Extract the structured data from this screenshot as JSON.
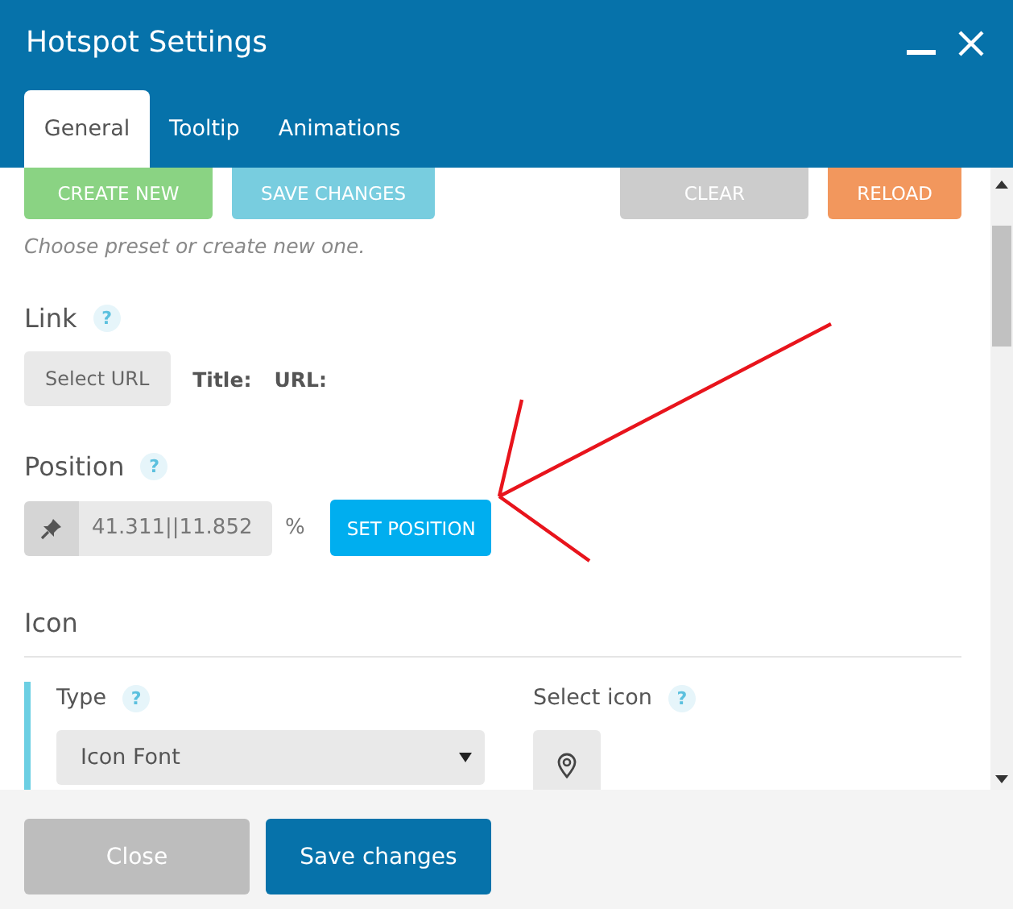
{
  "window": {
    "title": "Hotspot Settings"
  },
  "tabs": [
    {
      "label": "General",
      "selected": true
    },
    {
      "label": "Tooltip",
      "selected": false
    },
    {
      "label": "Animations",
      "selected": false
    }
  ],
  "presets": {
    "buttons": [
      {
        "label": "CREATE NEW",
        "kind": "create"
      },
      {
        "label": "SAVE CHANGES",
        "kind": "save"
      },
      {
        "label": "CLEAR",
        "kind": "clear"
      },
      {
        "label": "RELOAD",
        "kind": "reload"
      }
    ],
    "hint": "Choose preset or create new one."
  },
  "link": {
    "label": "Link",
    "help": "?",
    "button": "Select URL",
    "fields": [
      "Title:",
      "URL:"
    ]
  },
  "position": {
    "label": "Position",
    "help": "?",
    "value": "41.311||11.852",
    "unit": "%",
    "button": "SET POSITION"
  },
  "icon": {
    "label": "Icon",
    "type": {
      "label": "Type",
      "help": "?",
      "value": "Icon Font"
    },
    "select_icon": {
      "label": "Select icon",
      "help": "?"
    }
  },
  "footer": {
    "buttons": [
      {
        "label": "Close",
        "kind": "secondary"
      },
      {
        "label": "Save changes",
        "kind": "primary"
      }
    ]
  }
}
